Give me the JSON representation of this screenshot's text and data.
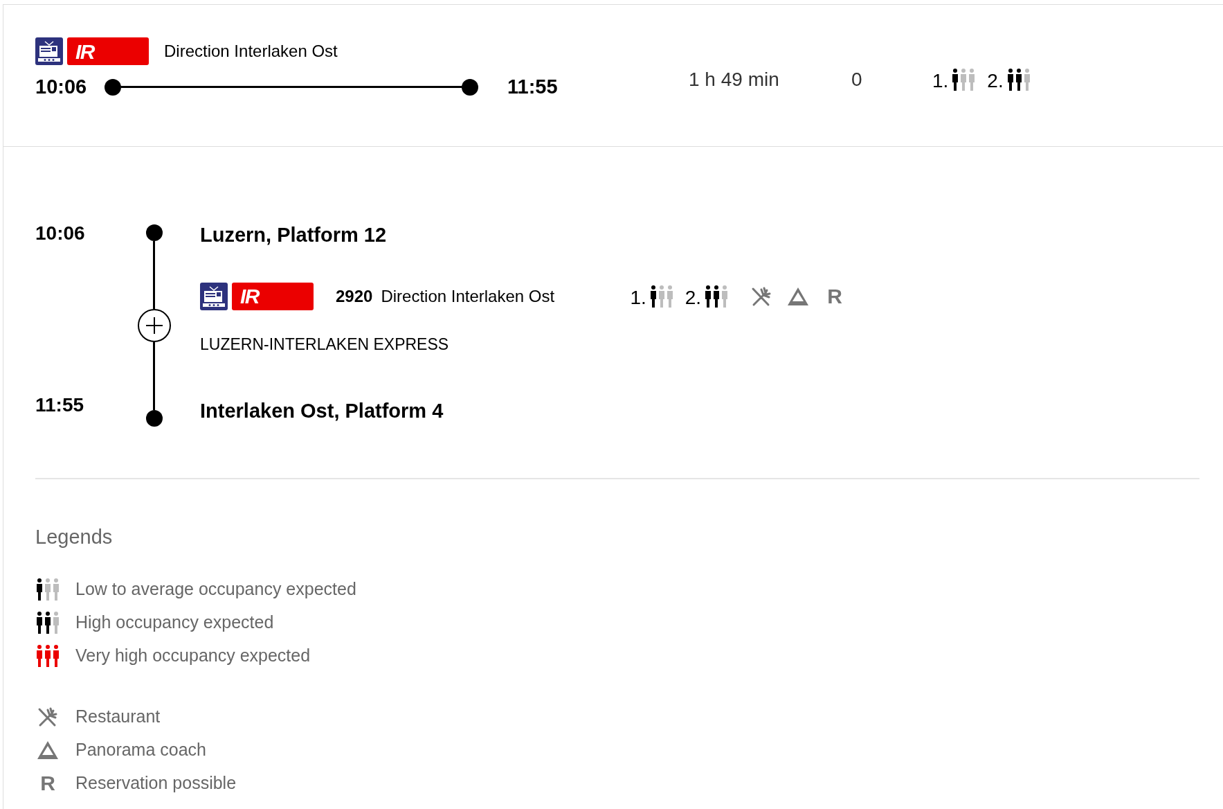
{
  "summary": {
    "product": "IR",
    "direction": "Direction Interlaken Ost",
    "departure": "10:06",
    "arrival": "11:55",
    "duration": "1 h 49 min",
    "changes": "0",
    "occupancy": [
      {
        "class": "1.",
        "kind": "low"
      },
      {
        "class": "2.",
        "kind": "high"
      }
    ]
  },
  "details": {
    "expanded": false,
    "departure": {
      "time": "10:06",
      "station": "Luzern, Platform 12"
    },
    "train": {
      "product": "IR",
      "number": "2920",
      "direction": "Direction Interlaken Ost",
      "name": "LUZERN-INTERLAKEN EXPRESS",
      "occupancy": [
        {
          "class": "1.",
          "kind": "low"
        },
        {
          "class": "2.",
          "kind": "high"
        }
      ],
      "features": [
        {
          "kind": "restaurant"
        },
        {
          "kind": "panorama"
        },
        {
          "kind": "reservation",
          "symbol": "R"
        }
      ]
    },
    "arrival": {
      "time": "11:55",
      "station": "Interlaken Ost, Platform 4"
    }
  },
  "legends": {
    "title": "Legends",
    "occupancy": [
      {
        "kind": "low",
        "label": "Low to average occupancy expected"
      },
      {
        "kind": "high",
        "label": "High occupancy expected"
      },
      {
        "kind": "very_high",
        "label": "Very high occupancy expected"
      }
    ],
    "features": [
      {
        "kind": "restaurant",
        "label": "Restaurant"
      },
      {
        "kind": "panorama",
        "label": "Panorama coach"
      },
      {
        "kind": "reservation",
        "symbol": "R",
        "label": "Reservation possible"
      }
    ]
  }
}
